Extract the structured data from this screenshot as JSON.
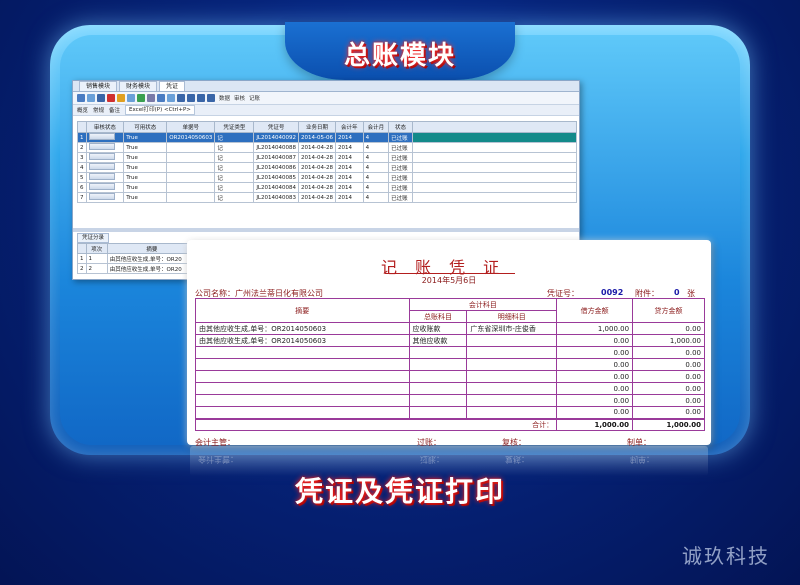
{
  "banner": {
    "top_title": "总账模块",
    "bottom_title": "凭证及凭证打印",
    "brand": "诚玖科技"
  },
  "software": {
    "tabs": [
      "销售模块",
      "财务模块",
      "凭证"
    ],
    "toolbar_labels": [
      "数据",
      "审核",
      "记账"
    ],
    "subtabs": [
      "概览",
      "常规",
      "备注"
    ],
    "print_shortcut": "Excel打印(P) <Ctrl+P>",
    "columns": [
      "审核状态",
      "可用状态",
      "单据号",
      "凭证类型",
      "凭证号",
      "业务日期",
      "会计年",
      "会计月",
      "状态"
    ],
    "rows": [
      {
        "idx": "1",
        "avail": "True",
        "doc": "OR2014050603",
        "type": "记",
        "no": "JL2014040092",
        "date": "2014-05-06",
        "year": "2014",
        "month": "4",
        "status": "已过账"
      },
      {
        "idx": "2",
        "avail": "True",
        "doc": "",
        "type": "记",
        "no": "JL2014040088",
        "date": "2014-04-28",
        "year": "2014",
        "month": "4",
        "status": "已过账"
      },
      {
        "idx": "3",
        "avail": "True",
        "doc": "",
        "type": "记",
        "no": "JL2014040087",
        "date": "2014-04-28",
        "year": "2014",
        "month": "4",
        "status": "已过账"
      },
      {
        "idx": "4",
        "avail": "True",
        "doc": "",
        "type": "记",
        "no": "JL2014040086",
        "date": "2014-04-28",
        "year": "2014",
        "month": "4",
        "status": "已过账"
      },
      {
        "idx": "5",
        "avail": "True",
        "doc": "",
        "type": "记",
        "no": "JL2014040085",
        "date": "2014-04-28",
        "year": "2014",
        "month": "4",
        "status": "已过账"
      },
      {
        "idx": "6",
        "avail": "True",
        "doc": "",
        "type": "记",
        "no": "JL2014040084",
        "date": "2014-04-28",
        "year": "2014",
        "month": "4",
        "status": "已过账"
      },
      {
        "idx": "7",
        "avail": "True",
        "doc": "",
        "type": "记",
        "no": "JL2014040083",
        "date": "2014-04-28",
        "year": "2014",
        "month": "4",
        "status": "已过账"
      }
    ],
    "detail_tab": "凭证分录",
    "detail_columns": [
      "项次",
      "摘要"
    ],
    "detail_rows": [
      {
        "idx": "1",
        "seq": "1",
        "summary": "由其他应收生成,单号：OR20"
      },
      {
        "idx": "2",
        "seq": "2",
        "summary": "由其他应收生成,单号：OR20"
      }
    ]
  },
  "voucher": {
    "title": "记账凭证",
    "date": "2014年5月6日",
    "company_label": "公司名称：",
    "company": "广州法兰蒂日化有限公司",
    "no_label": "凭证号：",
    "no": "0092",
    "attach_label": "附件：",
    "attach": "0",
    "attach_unit": "张",
    "col_summary": "摘要",
    "col_account": "会计科目",
    "col_general": "总账科目",
    "col_detail": "明细科目",
    "col_debit": "借方金额",
    "col_credit": "贷方金额",
    "lines": [
      {
        "summary": "由其他应收生成,单号：OR2014050603",
        "general": "应收账款",
        "detail": "广东省深圳市-庄俊香",
        "debit": "1,000.00",
        "credit": "0.00"
      },
      {
        "summary": "由其他应收生成,单号：OR2014050603",
        "general": "其他应收款",
        "detail": "",
        "debit": "0.00",
        "credit": "1,000.00"
      },
      {
        "summary": "",
        "general": "",
        "detail": "",
        "debit": "0.00",
        "credit": "0.00"
      },
      {
        "summary": "",
        "general": "",
        "detail": "",
        "debit": "0.00",
        "credit": "0.00"
      },
      {
        "summary": "",
        "general": "",
        "detail": "",
        "debit": "0.00",
        "credit": "0.00"
      },
      {
        "summary": "",
        "general": "",
        "detail": "",
        "debit": "0.00",
        "credit": "0.00"
      },
      {
        "summary": "",
        "general": "",
        "detail": "",
        "debit": "0.00",
        "credit": "0.00"
      },
      {
        "summary": "",
        "general": "",
        "detail": "",
        "debit": "0.00",
        "credit": "0.00"
      }
    ],
    "total_label": "合计：",
    "total_debit": "1,000.00",
    "total_credit": "1,000.00",
    "sign_manager": "会计主管：",
    "sign_post": "过账：",
    "sign_review": "复核：",
    "sign_maker": "制单："
  }
}
